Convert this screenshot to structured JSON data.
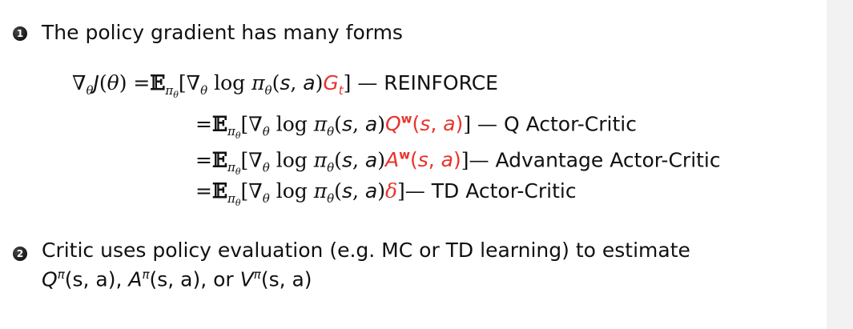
{
  "bullets": [
    {
      "number": "1",
      "text": "The policy gradient has many forms"
    },
    {
      "number": "2",
      "text": "Critic uses policy evaluation (e.g. MC or TD learning) to estimate",
      "text_line2_parts": [
        "Q",
        "π",
        "(s, a), ",
        "A",
        "π",
        "(s, a), or ",
        "V",
        "π",
        "(s, a)"
      ]
    }
  ],
  "equations": {
    "lhs": "∇θJ(θ) =",
    "lines": [
      {
        "prefix": "𝔼πθ[∇θ log πθ(s, a)",
        "highlight": "Gt",
        "suffix": "] — ",
        "method": "REINFORCE"
      },
      {
        "prefix": "𝔼πθ[∇θ log πθ(s, a)",
        "highlight": "Qw(s, a)",
        "suffix": "] — ",
        "method": "Q Actor-Critic"
      },
      {
        "prefix": "𝔼πθ[∇θ log πθ(s, a)",
        "highlight": "Aw(s, a)",
        "suffix": "]— ",
        "method": "Advantage Actor-Critic"
      },
      {
        "prefix": "𝔼πθ[∇θ log πθ(s, a)",
        "highlight": "δ",
        "suffix": "]— ",
        "method": "TD Actor-Critic"
      }
    ]
  },
  "colors": {
    "highlight": "#e8332b",
    "text": "#111111",
    "side_strip": "#f2f2f2"
  }
}
